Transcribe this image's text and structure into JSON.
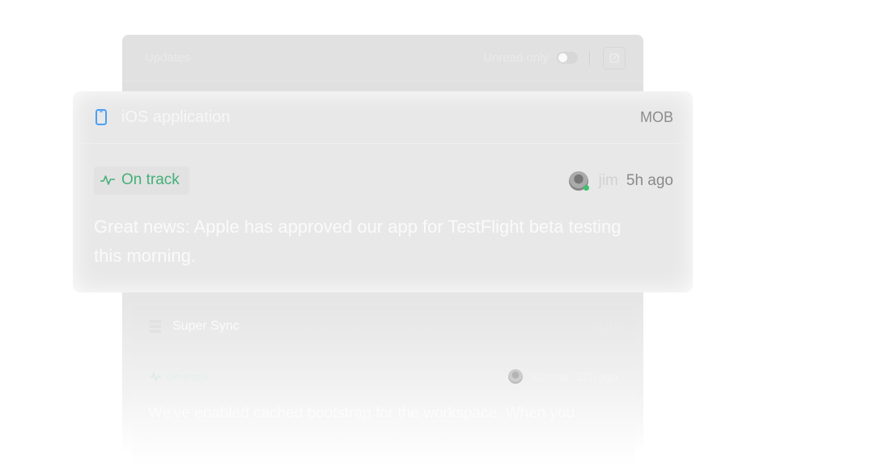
{
  "updates_panel": {
    "title": "Updates",
    "unread_only_label": "Unread only",
    "unread_only_enabled": false,
    "icons": {
      "compose": "edit-square-icon"
    }
  },
  "featured_update": {
    "project_name": "iOS application",
    "project_code": "MOB",
    "project_icon": "mobile-phone-icon",
    "status": "On track",
    "status_icon": "pulse-icon",
    "status_color": "#45b07a",
    "project_icon_color": "#4a9ff5",
    "author": "jim",
    "time": "5h ago",
    "body": "Great news: Apple has approved our app for TestFlight beta testing this morning."
  },
  "second_update": {
    "project_name": "Super Sync",
    "project_code": "LIN",
    "project_icon": "database-icon",
    "status": "On track",
    "author": "tuomas",
    "time": "22h ago",
    "body": "We've enabled cached bootstrap for the workspace. When you"
  }
}
